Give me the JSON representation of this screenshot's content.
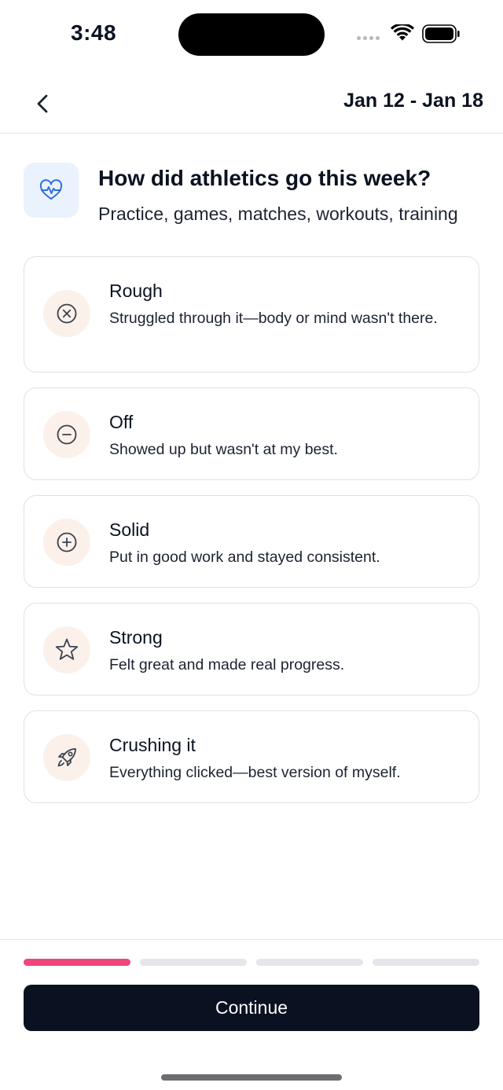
{
  "status_bar": {
    "time": "3:48",
    "icons": [
      "signal-dots-icon",
      "wifi-icon",
      "battery-icon"
    ]
  },
  "header": {
    "back_icon": "chevron-left-icon",
    "date_range": "Jan 12 - Jan 18"
  },
  "question": {
    "icon": "heart-pulse-icon",
    "title": "How did athletics go this week?",
    "subtitle": "Practice, games, matches, workouts, training"
  },
  "options": [
    {
      "icon": "x-circle-icon",
      "title": "Rough",
      "description": "Struggled through it—body or mind wasn't there."
    },
    {
      "icon": "minus-circle-icon",
      "title": "Off",
      "description": "Showed up but wasn't at my best."
    },
    {
      "icon": "plus-circle-icon",
      "title": "Solid",
      "description": "Put in good work and stayed consistent."
    },
    {
      "icon": "star-icon",
      "title": "Strong",
      "description": "Felt great and made real progress."
    },
    {
      "icon": "rocket-icon",
      "title": "Crushing it",
      "description": "Everything clicked—best version of myself."
    }
  ],
  "progress": {
    "current_step": 1,
    "total_steps": 4
  },
  "footer": {
    "continue_label": "Continue"
  },
  "colors": {
    "accent": "#f0457a",
    "button_bg": "#0a1120",
    "option_icon_bg": "#fbf1ea",
    "question_icon_bg": "#eaf2fe",
    "question_icon_stroke": "#2f6fe0"
  }
}
